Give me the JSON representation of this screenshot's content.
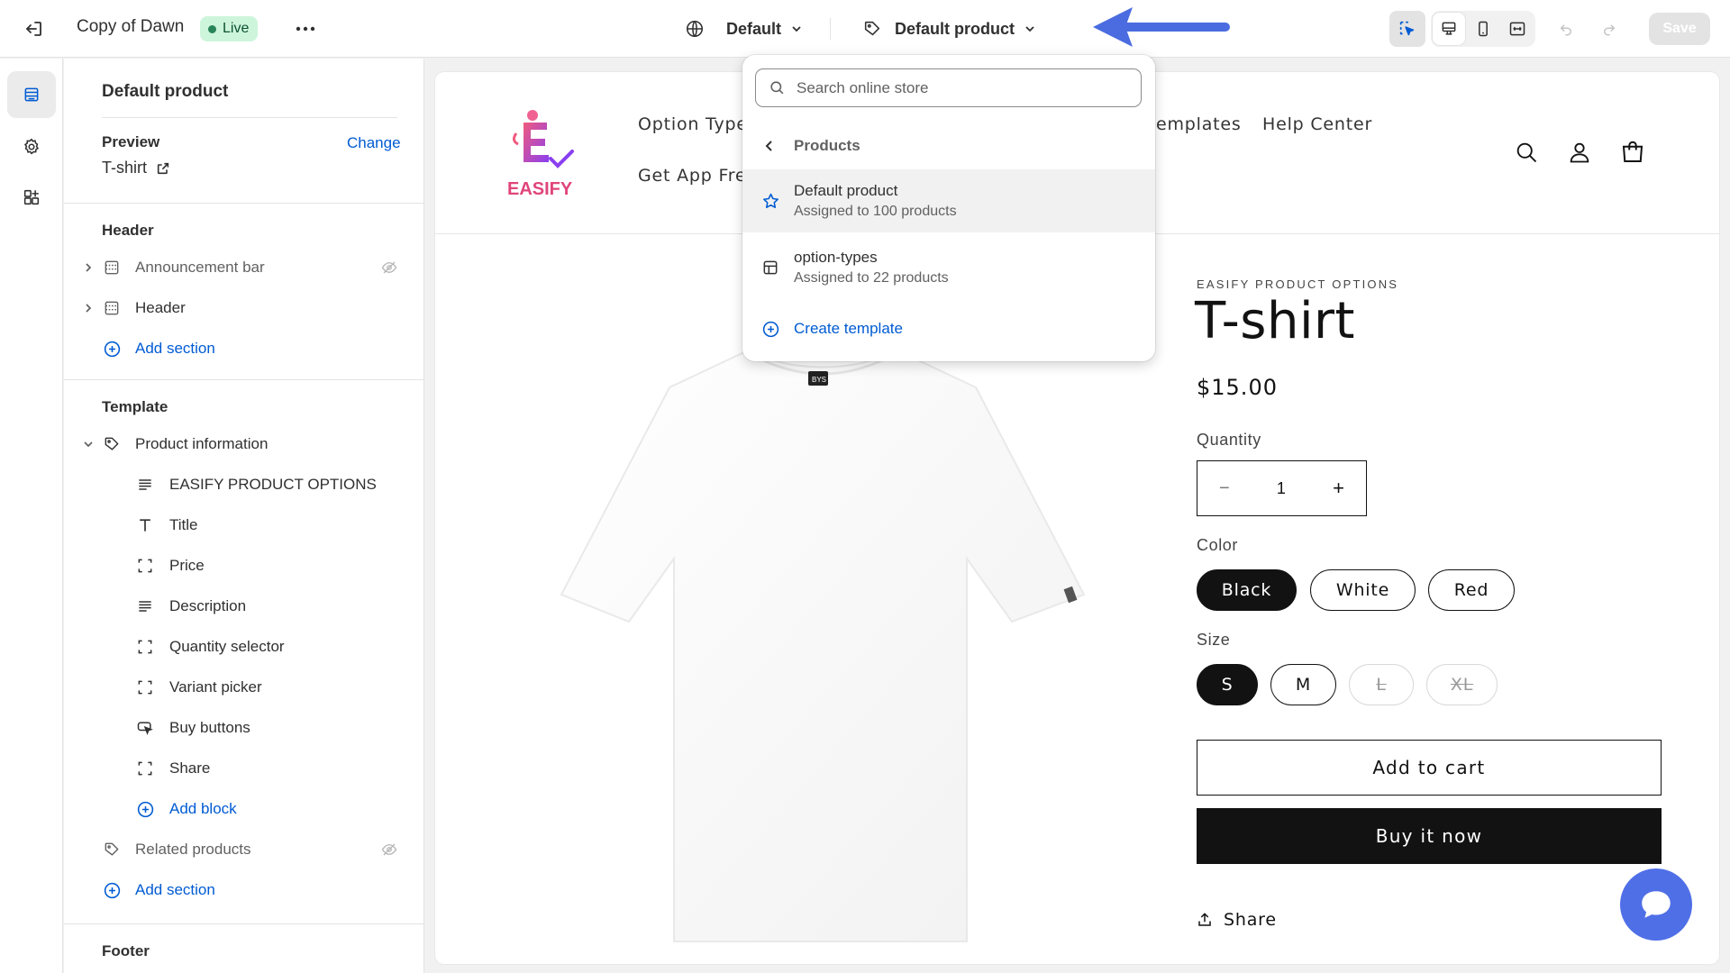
{
  "topbar": {
    "theme_name": "Copy of Dawn",
    "status": "Live",
    "more": "•••",
    "language_selector": "Default",
    "template_selector": "Default product",
    "save_label": "Save"
  },
  "sidebar": {
    "title": "Default product",
    "preview_label": "Preview",
    "change_link": "Change",
    "preview_product": "T-shirt",
    "header_group": {
      "label": "Header",
      "items": [
        {
          "label": "Announcement bar",
          "hidden": true
        },
        {
          "label": "Header",
          "hidden": false
        }
      ],
      "add_section": "Add section"
    },
    "template_group": {
      "label": "Template",
      "section": "Product information",
      "blocks": [
        {
          "label": "EASIFY PRODUCT OPTIONS",
          "icon": "text-lines-icon"
        },
        {
          "label": "Title",
          "icon": "title-t-icon"
        },
        {
          "label": "Price",
          "icon": "block-frame-icon"
        },
        {
          "label": "Description",
          "icon": "text-lines-icon"
        },
        {
          "label": "Quantity selector",
          "icon": "block-frame-icon"
        },
        {
          "label": "Variant picker",
          "icon": "block-frame-icon"
        },
        {
          "label": "Buy buttons",
          "icon": "cursor-button-icon"
        },
        {
          "label": "Share",
          "icon": "block-frame-icon"
        }
      ],
      "add_block": "Add block",
      "related": "Related products",
      "add_section": "Add section"
    },
    "footer_label": "Footer"
  },
  "dropdown": {
    "search_placeholder": "Search online store",
    "back_label": "Products",
    "items": [
      {
        "title": "Default product",
        "subtitle": "Assigned to 100 products",
        "icon": "star-icon",
        "selected": true
      },
      {
        "title": "option-types",
        "subtitle": "Assigned to 22 products",
        "icon": "layout-icon",
        "selected": false
      }
    ],
    "create_label": "Create template"
  },
  "store": {
    "logo_text": "EASIFY",
    "nav": [
      "Option Type",
      "emplates",
      "Help Center",
      "Get App Fre"
    ],
    "vendor": "EASIFY PRODUCT OPTIONS",
    "title": "T-shirt",
    "price": "$15.00",
    "quantity_label": "Quantity",
    "quantity": "1",
    "minus": "−",
    "plus": "+",
    "color_label": "Color",
    "colors": [
      {
        "label": "Black",
        "selected": true
      },
      {
        "label": "White",
        "selected": false
      },
      {
        "label": "Red",
        "selected": false
      }
    ],
    "size_label": "Size",
    "sizes": [
      {
        "label": "S",
        "selected": true,
        "available": true
      },
      {
        "label": "M",
        "selected": false,
        "available": true
      },
      {
        "label": "L",
        "selected": false,
        "available": false
      },
      {
        "label": "XL",
        "selected": false,
        "available": false
      }
    ],
    "add_to_cart": "Add to cart",
    "buy_now": "Buy it now",
    "share": "Share",
    "tag_text": "BYS"
  },
  "colors": {
    "accent_blue": "#005bd3",
    "live_bg": "#cdf5dc",
    "arrow": "#4a6ce0",
    "chat": "#4f6fe7",
    "dark": "#121212"
  }
}
